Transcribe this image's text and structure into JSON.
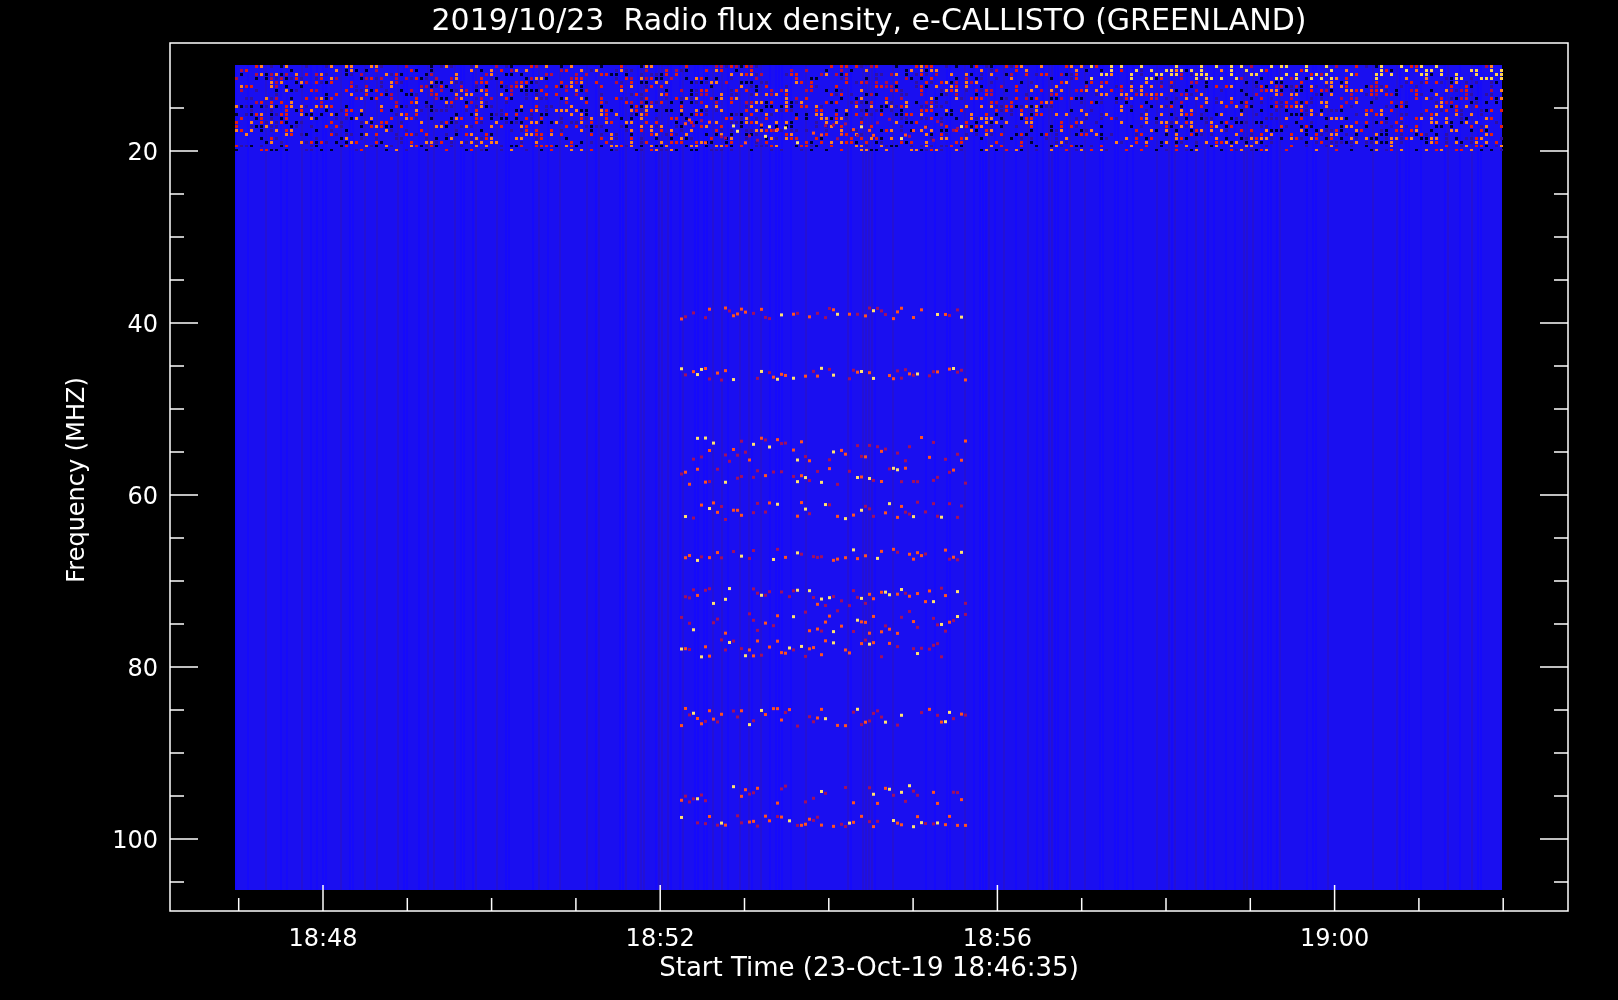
{
  "title": "2019/10/23  Radio flux density, e-CALLISTO (GREENLAND)",
  "y_axis": {
    "label": "Frequency (MHZ)",
    "ticks": [
      "20",
      "40",
      "60",
      "80",
      "100"
    ]
  },
  "x_axis": {
    "label": "Start Time (23-Oct-19 18:46:35)",
    "ticks": [
      "18:48",
      "18:52",
      "18:56",
      "19:00"
    ]
  }
}
